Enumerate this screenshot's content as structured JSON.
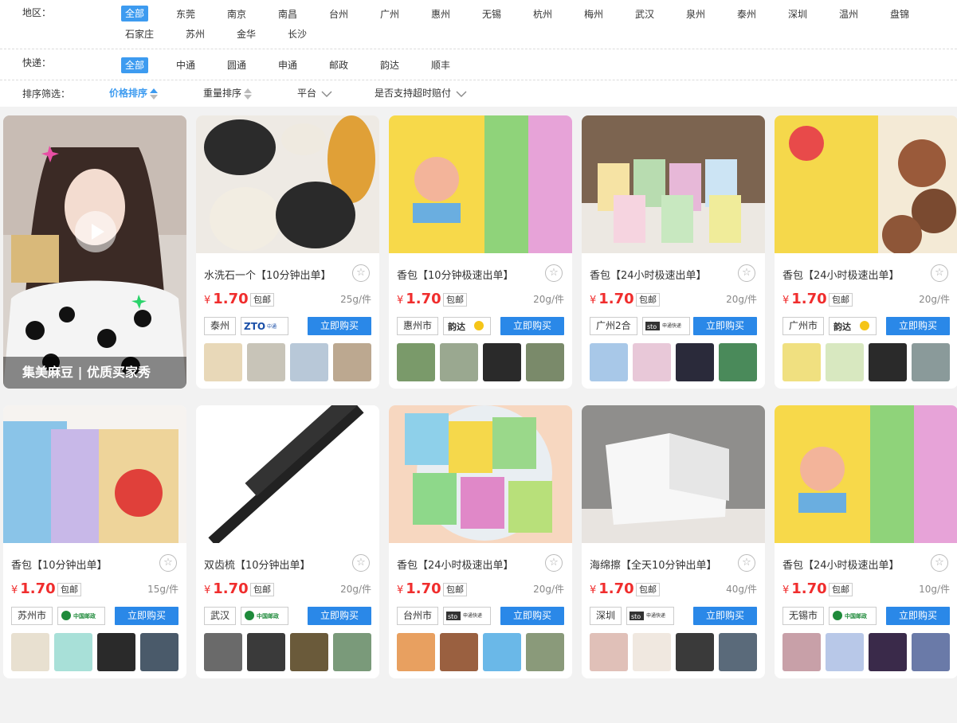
{
  "filters": {
    "region": {
      "label": "地区：",
      "options": [
        "全部",
        "东莞",
        "南京",
        "南昌",
        "台州",
        "广州",
        "惠州",
        "无锡",
        "杭州",
        "梅州",
        "武汉",
        "泉州",
        "泰州",
        "深圳",
        "温州",
        "盘锦",
        "石家庄",
        "苏州",
        "金华",
        "长沙"
      ],
      "active": "全部"
    },
    "courier": {
      "label": "快递：",
      "options": [
        "全部",
        "中通",
        "圆通",
        "申通",
        "邮政",
        "韵达",
        "顺丰"
      ],
      "active": "全部"
    },
    "sort": {
      "label": "排序筛选：",
      "price_sort": "价格排序",
      "weight_sort": "重量排序",
      "platform": "平台",
      "overtime_comp": "是否支持超时赔付"
    }
  },
  "video": {
    "caption": "集美麻豆 | 优质买家秀",
    "play_icon": "play-icon"
  },
  "products": [
    {
      "title": "水洗石一个【10分钟出单】",
      "price": "1.70",
      "currency": "¥",
      "shipping": "包邮",
      "weight": "25g/件",
      "city": "泰州",
      "courier": "ZTO中通快递",
      "buy": "立即购买"
    },
    {
      "title": "香包【10分钟极速出单】",
      "price": "1.70",
      "currency": "¥",
      "shipping": "包邮",
      "weight": "20g/件",
      "city": "惠州市",
      "courier": "韵达",
      "buy": "立即购买"
    },
    {
      "title": "香包【24小时极速出单】",
      "price": "1.70",
      "currency": "¥",
      "shipping": "包邮",
      "weight": "20g/件",
      "city": "广州2合",
      "courier": "sto申通快递",
      "buy": "立即购买"
    },
    {
      "title": "香包【24小时极速出单】",
      "price": "1.70",
      "currency": "¥",
      "shipping": "包邮",
      "weight": "20g/件",
      "city": "广州市",
      "courier": "韵达",
      "buy": "立即购买"
    },
    {
      "title": "香包【10分钟出单】",
      "price": "1.70",
      "currency": "¥",
      "shipping": "包邮",
      "weight": "15g/件",
      "city": "苏州市",
      "courier": "中国邮政",
      "buy": "立即购买"
    },
    {
      "title": "双齿梳【10分钟出单】",
      "price": "1.70",
      "currency": "¥",
      "shipping": "包邮",
      "weight": "20g/件",
      "city": "武汉",
      "courier": "中国邮政",
      "buy": "立即购买"
    },
    {
      "title": "香包【24小时极速出单】",
      "price": "1.70",
      "currency": "¥",
      "shipping": "包邮",
      "weight": "20g/件",
      "city": "台州市",
      "courier": "sto申通快递",
      "buy": "立即购买"
    },
    {
      "title": "海绵擦【全天10分钟出单】",
      "price": "1.70",
      "currency": "¥",
      "shipping": "包邮",
      "weight": "40g/件",
      "city": "深圳",
      "courier": "sto申通快递",
      "buy": "立即购买"
    },
    {
      "title": "香包【24小时极速出单】",
      "price": "1.70",
      "currency": "¥",
      "shipping": "包邮",
      "weight": "10g/件",
      "city": "无锡市",
      "courier": "中国邮政",
      "buy": "立即购买"
    }
  ],
  "colors": {
    "accent": "#3d9bf0",
    "price": "#f02d2d",
    "buy_button": "#2a88e8"
  }
}
